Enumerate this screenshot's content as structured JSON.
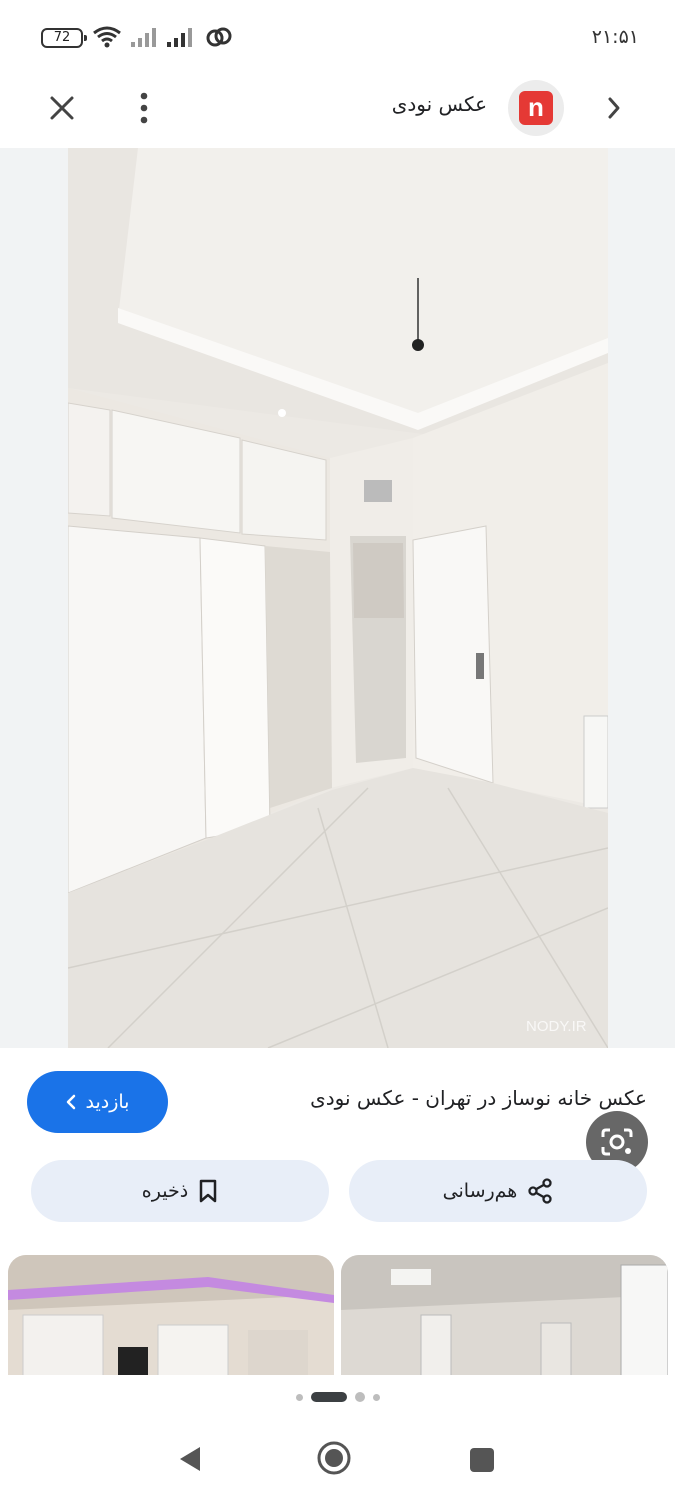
{
  "status_bar": {
    "battery": "72",
    "time": "۲۱:۵۱",
    "icons": [
      "wifi-icon",
      "signal-icon",
      "signal-icon",
      "link-icon"
    ]
  },
  "app_bar": {
    "site_name": "عکس نودی",
    "logo_letter": "n",
    "icons": [
      "close-icon",
      "more-vert-icon",
      "chevron-right-icon"
    ]
  },
  "image": {
    "watermark": "NODY.IR",
    "lens_icon": "google-lens-icon"
  },
  "result": {
    "title": "عکس خانه نوساز در تهران - عکس نودی",
    "visit_label": "بازدید",
    "save_label": "ذخیره",
    "share_label": "هم‌رسانی"
  },
  "pager": {
    "count": 4,
    "active": 1
  },
  "colors": {
    "accent": "#1a73e8",
    "action_bg": "#e8eef8",
    "logo_red": "#e53935"
  }
}
